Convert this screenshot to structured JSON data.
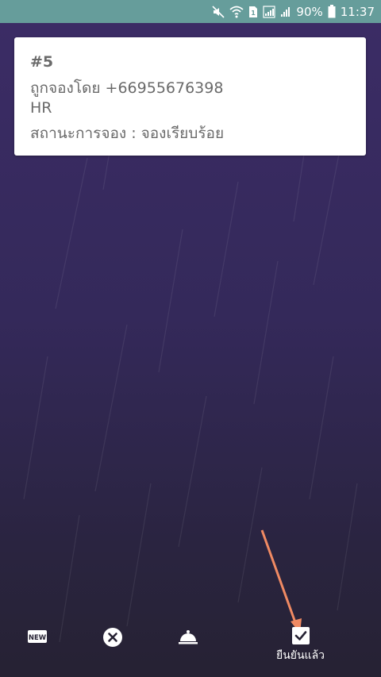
{
  "status_bar": {
    "battery_percent": "90%",
    "time": "11:37",
    "icons": [
      "mute-icon",
      "wifi-icon",
      "sim-icon",
      "signal-icon",
      "signal-icon",
      "battery-icon"
    ]
  },
  "booking": {
    "number": "#5",
    "booked_by": "ถูกจองโดย +66955676398",
    "department": "HR",
    "status": "สถานะการจอง : จองเรียบร้อย"
  },
  "bottom_bar": {
    "new_icon_text": "NEW",
    "confirmed_label": "ยืนยันแล้ว"
  },
  "colors": {
    "status_bar": "#669d9b",
    "background_top": "#3b2c65",
    "background_bottom": "#262233",
    "arrow": "#f08a63"
  }
}
